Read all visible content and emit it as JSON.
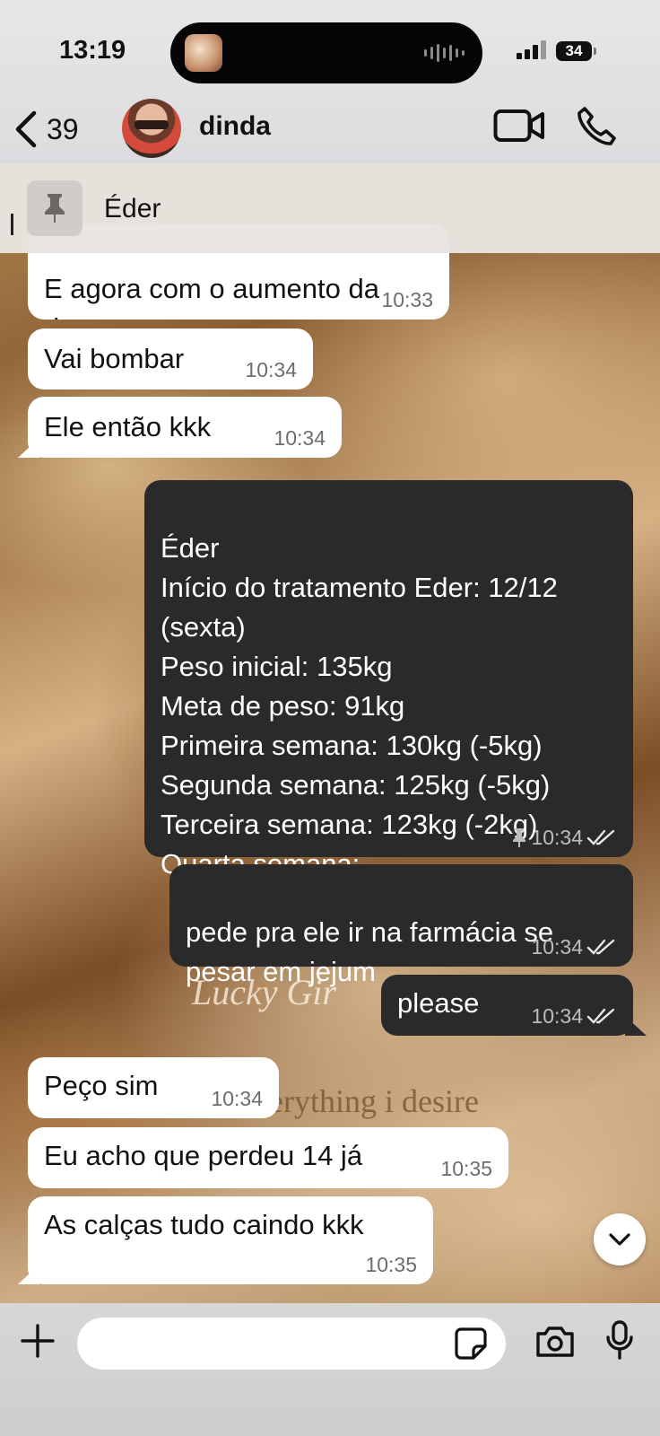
{
  "status": {
    "time": "13:19",
    "battery": "34"
  },
  "header": {
    "back_count": "39",
    "contact_name": "dinda"
  },
  "pinned": {
    "title": "Éder"
  },
  "wallpaper": {
    "text1": "Lucky Gir",
    "text2": "erything i desire"
  },
  "messages": [
    {
      "text": "E agora com o aumento da\ndose",
      "time": "10:33"
    },
    {
      "text": "Vai bombar",
      "time": "10:34"
    },
    {
      "text": "Ele então kkk",
      "time": "10:34"
    },
    {
      "text": "Éder\nInício do tratamento Eder: 12/12\n(sexta)\nPeso inicial: 135kg\nMeta de peso: 91kg\nPrimeira semana: 130kg (-5kg)\nSegunda semana: 125kg (-5kg)\nTerceira semana: 123kg (-2kg)\nQuarta semana:",
      "time": "10:34"
    },
    {
      "text": "pede pra ele ir na farmácia se\npesar em jejum",
      "time": "10:34"
    },
    {
      "text": "please",
      "time": "10:34"
    },
    {
      "text": "Peço sim",
      "time": "10:34"
    },
    {
      "text": "Eu acho que perdeu 14 já",
      "time": "10:35"
    },
    {
      "text": "As calças tudo caindo kkk",
      "time": "10:35"
    }
  ],
  "composer": {
    "placeholder": ""
  },
  "colors": {
    "incoming": "#ffffff",
    "outgoing": "#2a2a2c",
    "header_bg": "#e3e3e5"
  }
}
